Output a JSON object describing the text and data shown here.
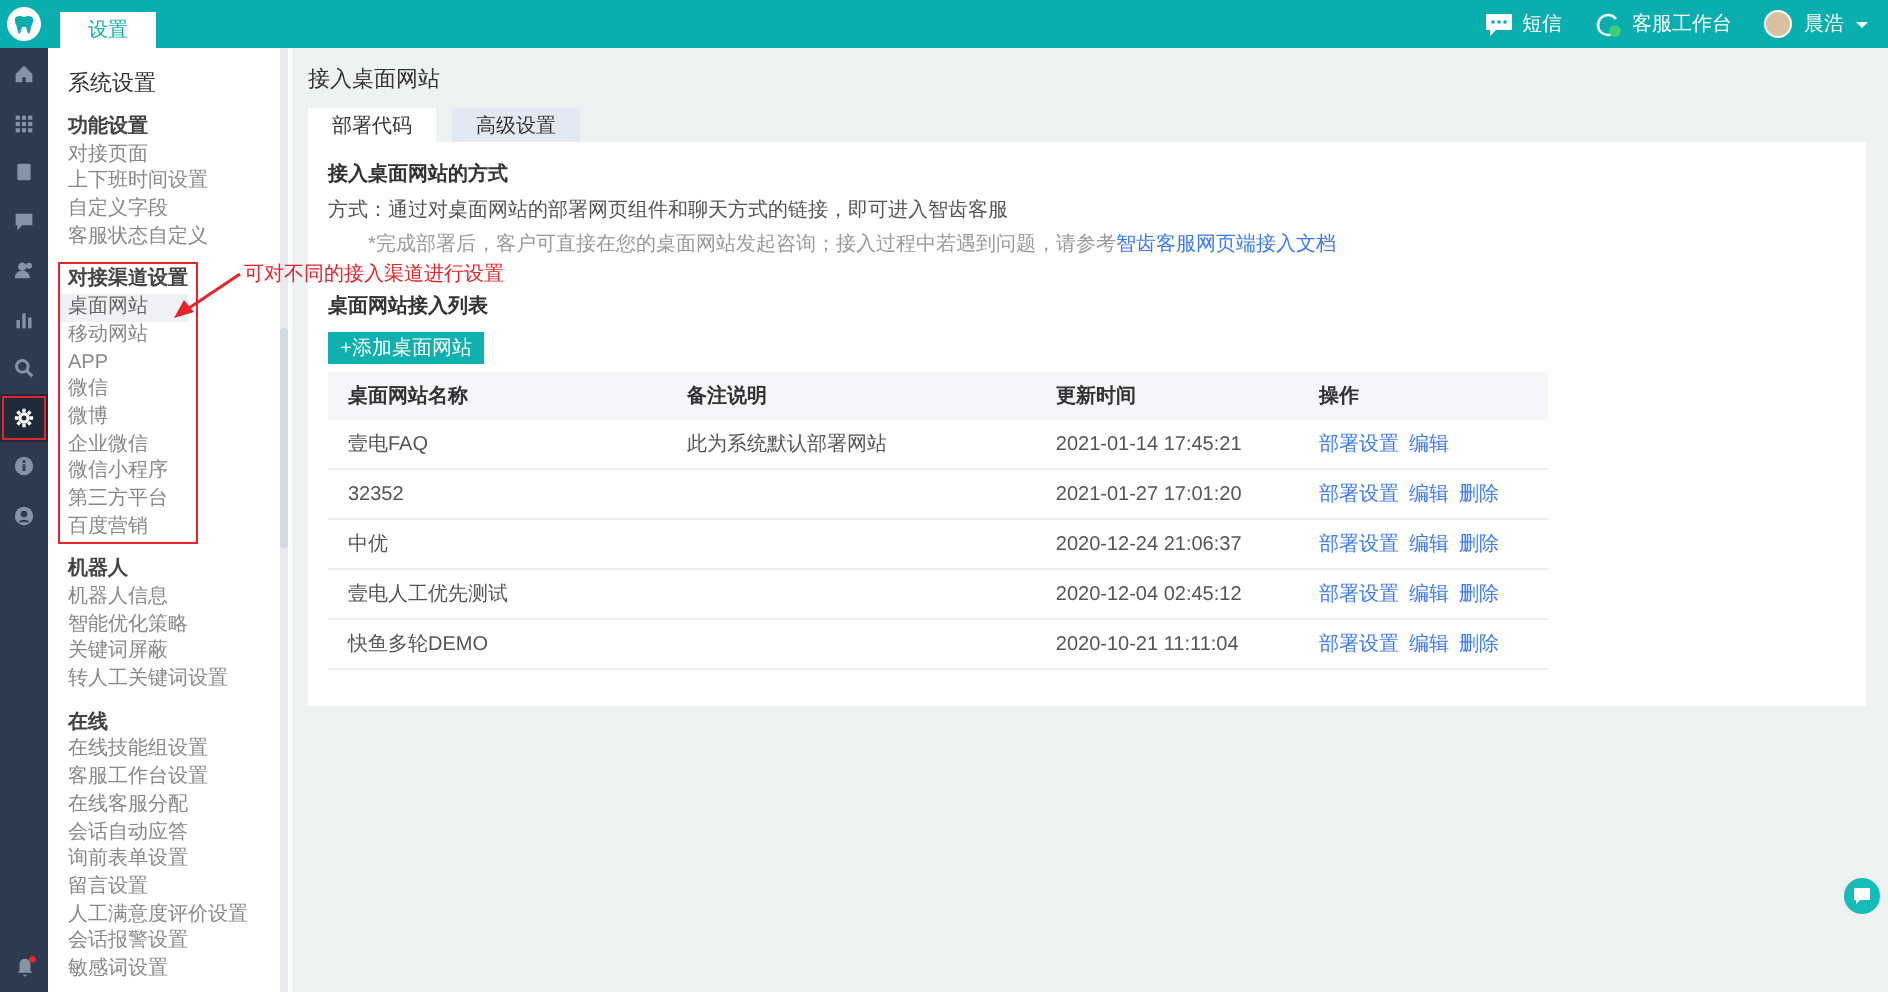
{
  "top_bar": {
    "tabs": [
      {
        "label": "设置",
        "selected": true
      }
    ],
    "actions": [
      {
        "kind": "sms",
        "label": "短信"
      },
      {
        "kind": "workbench",
        "label": "客服工作台"
      }
    ],
    "user": {
      "name": "晨浩"
    }
  },
  "rail": {
    "items": [
      {
        "kind": "home",
        "selected": false,
        "annotated": false
      },
      {
        "kind": "grid",
        "selected": false,
        "annotated": false
      },
      {
        "kind": "document",
        "selected": false,
        "annotated": false
      },
      {
        "kind": "chat",
        "selected": false,
        "annotated": false
      },
      {
        "kind": "users",
        "selected": false,
        "annotated": false
      },
      {
        "kind": "chart",
        "selected": false,
        "annotated": false
      },
      {
        "kind": "search",
        "selected": false,
        "annotated": false
      },
      {
        "kind": "settings",
        "selected": true,
        "annotated": true
      },
      {
        "kind": "info",
        "selected": false,
        "annotated": false
      },
      {
        "kind": "user",
        "selected": false,
        "annotated": false
      }
    ],
    "notifications": {
      "unread": true
    }
  },
  "sidebar": {
    "title": "系统设置",
    "groups": [
      {
        "title": "功能设置",
        "annotated": false,
        "items": [
          {
            "label": "对接页面",
            "selected": false
          },
          {
            "label": "上下班时间设置",
            "selected": false
          },
          {
            "label": "自定义字段",
            "selected": false
          },
          {
            "label": "客服状态自定义",
            "selected": false
          }
        ]
      },
      {
        "title": "对接渠道设置",
        "annotated": true,
        "items": [
          {
            "label": "桌面网站",
            "selected": true
          },
          {
            "label": "移动网站",
            "selected": false
          },
          {
            "label": "APP",
            "selected": false
          },
          {
            "label": "微信",
            "selected": false
          },
          {
            "label": "微博",
            "selected": false
          },
          {
            "label": "企业微信",
            "selected": false
          },
          {
            "label": "微信小程序",
            "selected": false
          },
          {
            "label": "第三方平台",
            "selected": false
          },
          {
            "label": "百度营销",
            "selected": false
          }
        ]
      },
      {
        "title": "机器人",
        "annotated": false,
        "items": [
          {
            "label": "机器人信息",
            "selected": false
          },
          {
            "label": "智能优化策略",
            "selected": false
          },
          {
            "label": "关键词屏蔽",
            "selected": false
          },
          {
            "label": "转人工关键词设置",
            "selected": false
          }
        ]
      },
      {
        "title": "在线",
        "annotated": false,
        "items": [
          {
            "label": "在线技能组设置",
            "selected": false
          },
          {
            "label": "客服工作台设置",
            "selected": false
          },
          {
            "label": "在线客服分配",
            "selected": false
          },
          {
            "label": "会话自动应答",
            "selected": false
          },
          {
            "label": "询前表单设置",
            "selected": false
          },
          {
            "label": "留言设置",
            "selected": false
          },
          {
            "label": "人工满意度评价设置",
            "selected": false
          },
          {
            "label": "会话报警设置",
            "selected": false
          },
          {
            "label": "敏感词设置",
            "selected": false
          }
        ]
      }
    ]
  },
  "content": {
    "title": "接入桌面网站",
    "tabs": [
      {
        "label": "部署代码",
        "selected": true
      },
      {
        "label": "高级设置",
        "selected": false
      }
    ],
    "section_title": "接入桌面网站的方式",
    "method_text": "方式：通过对桌面网站的部署网页组件和聊天方式的链接，即可进入智齿客服",
    "note": {
      "text": "*完成部署后，客户可直接在您的桌面网站发起咨询；接入过程中若遇到问题，请参考",
      "link": "智齿客服网页端接入文档"
    },
    "list_title": "桌面网站接入列表",
    "add_button": "+添加桌面网站",
    "table": {
      "columns": [
        "桌面网站名称",
        "备注说明",
        "更新时间",
        "操作"
      ],
      "rows": [
        {
          "cells": [
            "壹电FAQ",
            "此为系统默认部署网站",
            "2021-01-14 17:45:21"
          ],
          "actions": [
            "部署设置",
            "编辑"
          ]
        },
        {
          "cells": [
            "32352",
            "",
            "2021-01-27 17:01:20"
          ],
          "actions": [
            "部署设置",
            "编辑",
            "删除"
          ]
        },
        {
          "cells": [
            "中优",
            "",
            "2020-12-24 21:06:37"
          ],
          "actions": [
            "部署设置",
            "编辑",
            "删除"
          ]
        },
        {
          "cells": [
            "壹电人工优先测试",
            "",
            "2020-12-04 02:45:12"
          ],
          "actions": [
            "部署设置",
            "编辑",
            "删除"
          ]
        },
        {
          "cells": [
            "快鱼多轮DEMO",
            "",
            "2020-10-21 11:11:04"
          ],
          "actions": [
            "部署设置",
            "编辑",
            "删除"
          ]
        }
      ]
    }
  },
  "annotation": {
    "text": "可对不同的接入渠道进行设置"
  }
}
